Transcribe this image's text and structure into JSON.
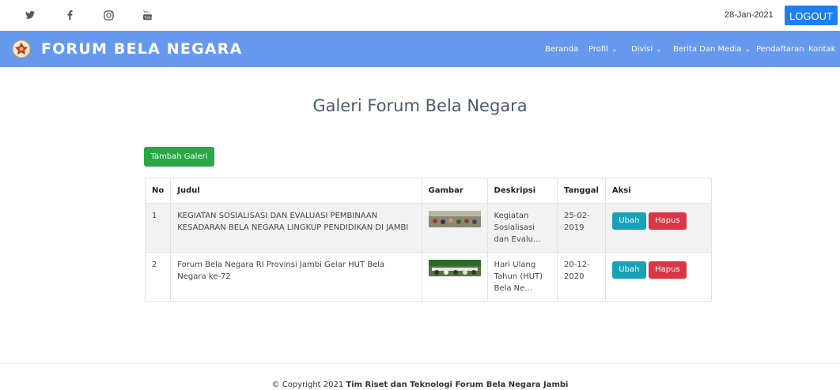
{
  "topbar": {
    "social_icons": [
      "twitter-icon",
      "facebook-icon",
      "instagram-icon",
      "youtube-icon"
    ],
    "date": "28-Jan-2021",
    "logout_label": "LOGOUT"
  },
  "navbar": {
    "brand": "FORUM BELA NEGARA",
    "items": [
      {
        "label": "Beranda",
        "dropdown": false
      },
      {
        "label": "Profil",
        "dropdown": true
      },
      {
        "label": "Divisi",
        "dropdown": true
      },
      {
        "label": "Berita Dan Media",
        "dropdown": true
      },
      {
        "label": "Pendaftaran",
        "dropdown": false
      },
      {
        "label": "Kontak",
        "dropdown": false
      }
    ]
  },
  "main": {
    "title": "Galeri Forum Bela Negara",
    "add_button": "Tambah Galeri",
    "table": {
      "headers": [
        "No",
        "Judul",
        "Gambar",
        "Deskripsi",
        "Tanggal",
        "Aksi"
      ],
      "rows": [
        {
          "no": "1",
          "judul": "KEGIATAN SOSIALISASI DAN EVALUASI PEMBINAAN KESADARAN BELA NEGARA LINGKUP PENDIDIKAN DI JAMBI",
          "deskripsi": "Kegiatan Sosialisasi dan Evalu...",
          "tanggal": "25-02-2019",
          "ubah": "Ubah",
          "hapus": "Hapus"
        },
        {
          "no": "2",
          "judul": "Forum Bela Negara RI Provinsi Jambi Gelar HUT Bela Negara ke-72",
          "deskripsi": "Hari Ulang Tahun (HUT) Bela Ne...",
          "tanggal": "20-12-2020",
          "ubah": "Ubah",
          "hapus": "Hapus"
        }
      ]
    }
  },
  "footer": {
    "prefix": "© Copyright 2021 ",
    "bold": "Tim Riset dan Teknologi Forum Bela Negara Jambi"
  },
  "colors": {
    "navbar": "#6699ee",
    "logout": "#1e7ff4",
    "add_button": "#28a745",
    "edit_button": "#17a2b8",
    "delete_button": "#dc3545"
  }
}
